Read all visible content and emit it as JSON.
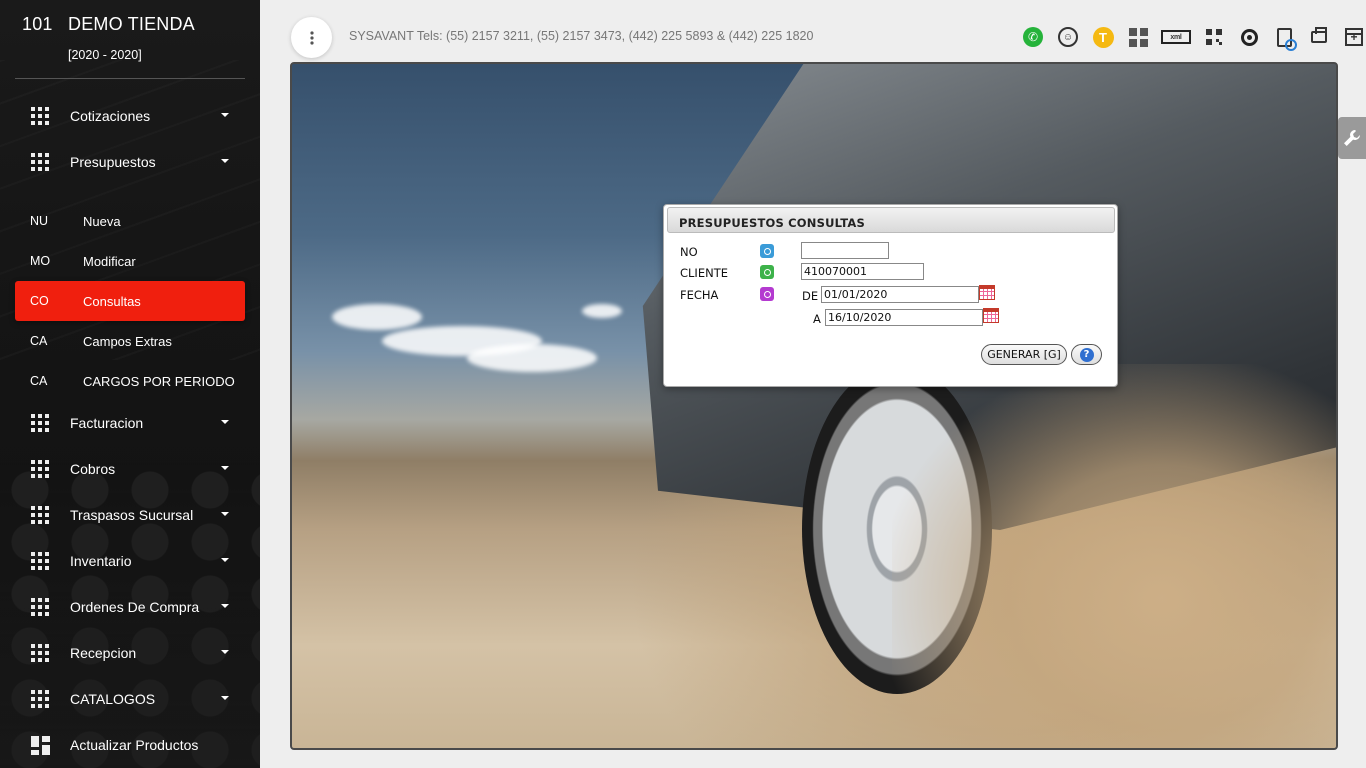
{
  "brand": {
    "store_number": "101",
    "store_name": "DEMO TIENDA",
    "years": "[2020 - 2020]"
  },
  "sidebar": {
    "menu": [
      {
        "label": "Cotizaciones",
        "type": "group"
      },
      {
        "label": "Presupuestos",
        "type": "group"
      }
    ],
    "submenu": [
      {
        "abbr": "NU",
        "label": "Nueva"
      },
      {
        "abbr": "MO",
        "label": "Modificar"
      },
      {
        "abbr": "CO",
        "label": "Consultas",
        "active": true
      },
      {
        "abbr": "CA",
        "label": "Campos Extras"
      },
      {
        "abbr": "CA",
        "label": "CARGOS POR PERIODO"
      }
    ],
    "menu_after": [
      {
        "label": "Facturacion"
      },
      {
        "label": "Cobros"
      },
      {
        "label": "Traspasos Sucursal"
      },
      {
        "label": "Inventario"
      },
      {
        "label": "Ordenes De Compra"
      },
      {
        "label": "Recepcion"
      },
      {
        "label": "CATALOGOS"
      },
      {
        "label": "Actualizar Productos"
      }
    ],
    "active_color": "#f01f0e"
  },
  "header": {
    "company_info": "SYSAVANT Tels: (55) 2157 3211, (55) 2157 3473, (442) 225 5893 & (442) 225 1820",
    "toolbar_icons": [
      "whatsapp-icon",
      "support-icon",
      "t-icon",
      "dashboard-icon",
      "xml-icon",
      "qr-icon",
      "target-icon",
      "document-search-icon",
      "printer-icon",
      "new-window-icon",
      "user-icon"
    ],
    "toolbar_t_label": "T",
    "toolbar_xml_label": "xml"
  },
  "dialog": {
    "title": "PRESUPUESTOS CONSULTAS",
    "fields": {
      "no_label": "NO",
      "no_value": "",
      "cliente_label": "CLIENTE",
      "cliente_value": "410070001",
      "fecha_label": "FECHA",
      "de_label": "DE",
      "de_value": "01/01/2020",
      "a_label": "A",
      "a_value": "16/10/2020"
    },
    "generate_button": "GENERAR [G]",
    "help_button": "?"
  },
  "tool_tab_icon": "wrench-icon"
}
